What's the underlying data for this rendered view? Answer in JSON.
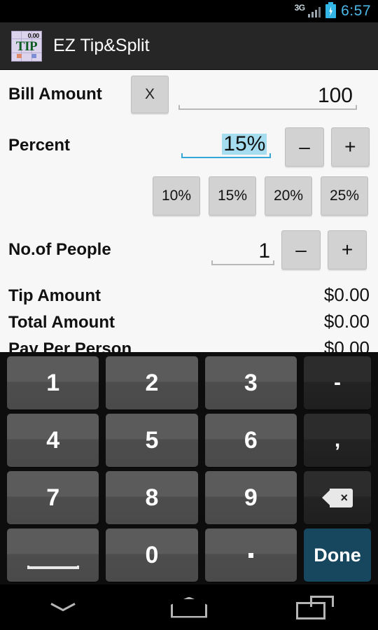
{
  "status_bar": {
    "network": "3G",
    "time": "6:57",
    "battery_state": "charging",
    "accent_color": "#33b5e5"
  },
  "action_bar": {
    "title": "EZ Tip&Split",
    "icon_top_text": "0.00",
    "icon_main_text": "TIP"
  },
  "form": {
    "bill": {
      "label": "Bill Amount",
      "clear_label": "X",
      "value": "100"
    },
    "percent": {
      "label": "Percent",
      "value": "15%",
      "selected": true,
      "minus_label": "–",
      "plus_label": "+",
      "presets": [
        "10%",
        "15%",
        "20%",
        "25%"
      ]
    },
    "people": {
      "label": "No.of People",
      "value": "1",
      "minus_label": "–",
      "plus_label": "+"
    }
  },
  "summary": [
    {
      "label": "Tip Amount",
      "amount": "$0.00"
    },
    {
      "label": "Total Amount",
      "amount": "$0.00"
    },
    {
      "label": "Pay Per Person",
      "amount": "$0.00"
    }
  ],
  "keyboard": {
    "rows": [
      [
        {
          "label": "1",
          "kind": "num"
        },
        {
          "label": "2",
          "kind": "num"
        },
        {
          "label": "3",
          "kind": "num"
        },
        {
          "label": "-",
          "kind": "dark"
        }
      ],
      [
        {
          "label": "4",
          "kind": "num"
        },
        {
          "label": "5",
          "kind": "num"
        },
        {
          "label": "6",
          "kind": "num"
        },
        {
          "label": ",",
          "kind": "dark"
        }
      ],
      [
        {
          "label": "7",
          "kind": "num"
        },
        {
          "label": "8",
          "kind": "num"
        },
        {
          "label": "9",
          "kind": "num"
        },
        {
          "label": "backspace-icon",
          "kind": "backspace"
        }
      ],
      [
        {
          "label": "space-icon",
          "kind": "space"
        },
        {
          "label": "0",
          "kind": "num"
        },
        {
          "label": ".",
          "kind": "period"
        },
        {
          "label": "Done",
          "kind": "done"
        }
      ]
    ],
    "done_color": "#17465f"
  },
  "nav_bar": {
    "back": "hide-keyboard-chevron-icon",
    "home": "home-icon",
    "recents": "recents-icon"
  }
}
